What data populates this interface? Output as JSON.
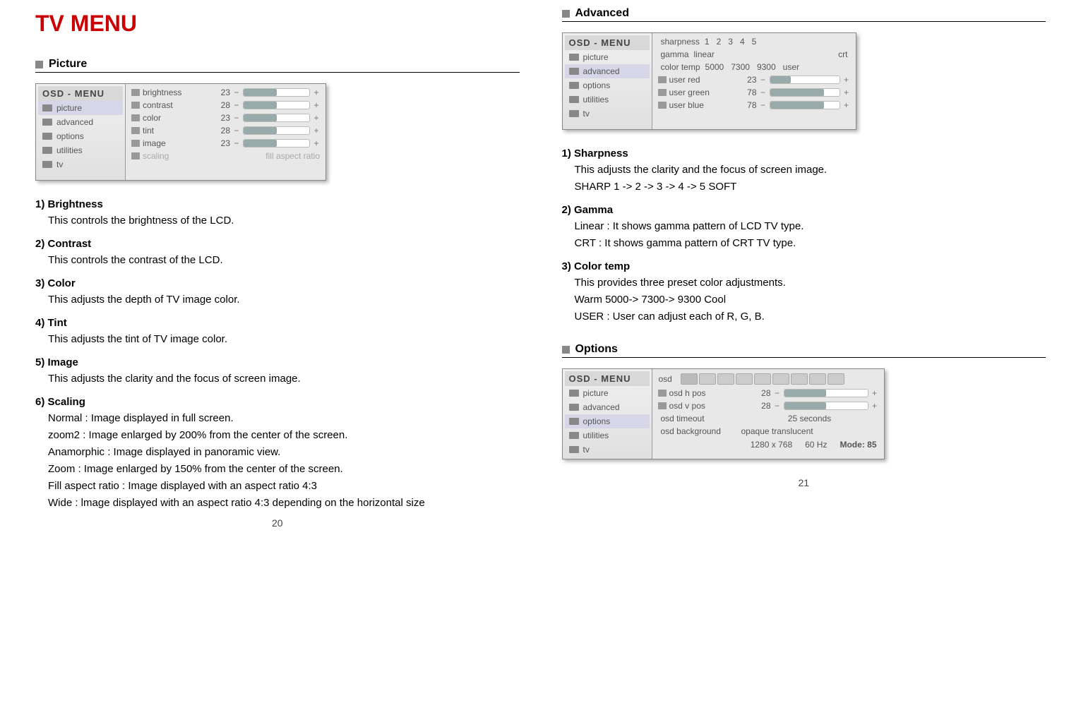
{
  "mainTitle": "TV MENU",
  "pageNumLeft": "20",
  "pageNumRight": "21",
  "leftColumn": {
    "sectionTitle": "Picture",
    "osd": {
      "title": "OSD - MENU",
      "sidebar": [
        "picture",
        "advanced",
        "options",
        "utilities",
        "tv"
      ],
      "rows": [
        {
          "label": "brightness",
          "val": "23"
        },
        {
          "label": "contrast",
          "val": "28"
        },
        {
          "label": "color",
          "val": "23"
        },
        {
          "label": "tint",
          "val": "28"
        },
        {
          "label": "image",
          "val": "23"
        },
        {
          "label": "scaling",
          "val": "fill aspect ratio",
          "dim": true
        }
      ]
    },
    "items": [
      {
        "h": "1) Brightness",
        "d": [
          "This controls the brightness of the LCD."
        ]
      },
      {
        "h": "2) Contrast",
        "d": [
          "This controls the contrast of the LCD."
        ]
      },
      {
        "h": "3) Color",
        "d": [
          "This adjusts the depth of TV image color."
        ]
      },
      {
        "h": "4) Tint",
        "d": [
          "This adjusts the tint of TV image color."
        ]
      },
      {
        "h": "5) Image",
        "d": [
          "This adjusts the clarity and the focus of screen image."
        ]
      },
      {
        "h": "6) Scaling",
        "d": [
          "Normal : Image displayed in full screen.",
          "zoom2 : Image enlarged by 200% from the center of the screen.",
          "Anamorphic : Image displayed in panoramic view.",
          "Zoom : Image enlarged by 150% from the center of the screen.",
          "Fill aspect ratio : Image displayed with an aspect ratio 4:3",
          "Wide : lmage displayed with an aspect ratio 4:3 depending on the horizontal size"
        ]
      }
    ]
  },
  "rightColumn": {
    "advanced": {
      "sectionTitle": "Advanced",
      "osd": {
        "title": "OSD - MENU",
        "sidebar": [
          "picture",
          "advanced",
          "options",
          "utilities",
          "tv"
        ],
        "rows": [
          {
            "label": "sharpness",
            "segs": [
              "1",
              "2",
              "3",
              "4",
              "5"
            ]
          },
          {
            "label": "gamma",
            "segs": [
              "linear",
              "",
              "crt"
            ]
          },
          {
            "label": "color temp",
            "segs": [
              "5000",
              "7300",
              "9300",
              "user"
            ]
          },
          {
            "label": "user red",
            "val": "23"
          },
          {
            "label": "user green",
            "val": "78"
          },
          {
            "label": "user blue",
            "val": "78"
          }
        ]
      },
      "items": [
        {
          "h": "1) Sharpness",
          "d": [
            "This adjusts the clarity and the focus of screen image.",
            "SHARP  1 -> 2 -> 3 -> 4 -> 5 SOFT"
          ]
        },
        {
          "h": "2) Gamma",
          "d": [
            "Linear : It shows gamma pattern of LCD TV type.",
            "CRT  : It shows gamma pattern of CRT TV type."
          ]
        },
        {
          "h": "3) Color temp",
          "d": [
            "This provides three preset color adjustments.",
            "Warm 5000-> 7300-> 9300 Cool",
            "USER : User can adjust each of R, G, B."
          ]
        }
      ]
    },
    "options": {
      "sectionTitle": "Options",
      "osd": {
        "title": "OSD - MENU",
        "sidebar": [
          "picture",
          "advanced",
          "options",
          "utilities",
          "tv"
        ],
        "tabsLabel": "osd",
        "rows": [
          {
            "label": "osd h pos",
            "val": "28"
          },
          {
            "label": "osd v pos",
            "val": "28"
          },
          {
            "label": "osd timeout",
            "text": "25    seconds"
          },
          {
            "label": "osd background",
            "text": "opaque    translucent"
          }
        ],
        "info": [
          "1280 x 768",
          "60 Hz",
          "Mode: 85"
        ]
      }
    }
  }
}
